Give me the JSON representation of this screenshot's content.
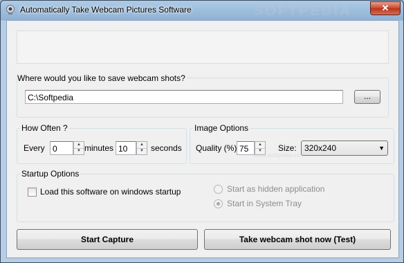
{
  "window": {
    "title": "Automatically Take Webcam Pictures Software",
    "close_label": "✕"
  },
  "save": {
    "group_label": "Where would you like to save webcam shots?",
    "path_value": "C:\\Softpedia",
    "browse_label": "..."
  },
  "how_often": {
    "group_label": "How Often ?",
    "every_label": "Every",
    "minutes_value": "0",
    "minutes_label": "minutes",
    "seconds_value": "10",
    "seconds_label": "seconds"
  },
  "image_options": {
    "group_label": "Image Options",
    "quality_label": "Quality (%):",
    "quality_value": "75",
    "size_label": "Size:",
    "size_value": "320x240"
  },
  "startup": {
    "group_label": "Startup Options",
    "load_on_startup_label": "Load this software on windows startup",
    "load_on_startup_checked": false,
    "hidden_app_label": "Start as hidden application",
    "system_tray_label": "Start in System Tray",
    "selected_mode": "system_tray"
  },
  "actions": {
    "start_capture_label": "Start Capture",
    "take_shot_label": "Take webcam shot now (Test)"
  },
  "watermark": {
    "brand": "SOFTPEDIA",
    "url": "www.softpedia.com"
  },
  "colors": {
    "title_bar": "#aecbe6",
    "close_button": "#c9452c",
    "client_bg": "#f0f0f0"
  }
}
